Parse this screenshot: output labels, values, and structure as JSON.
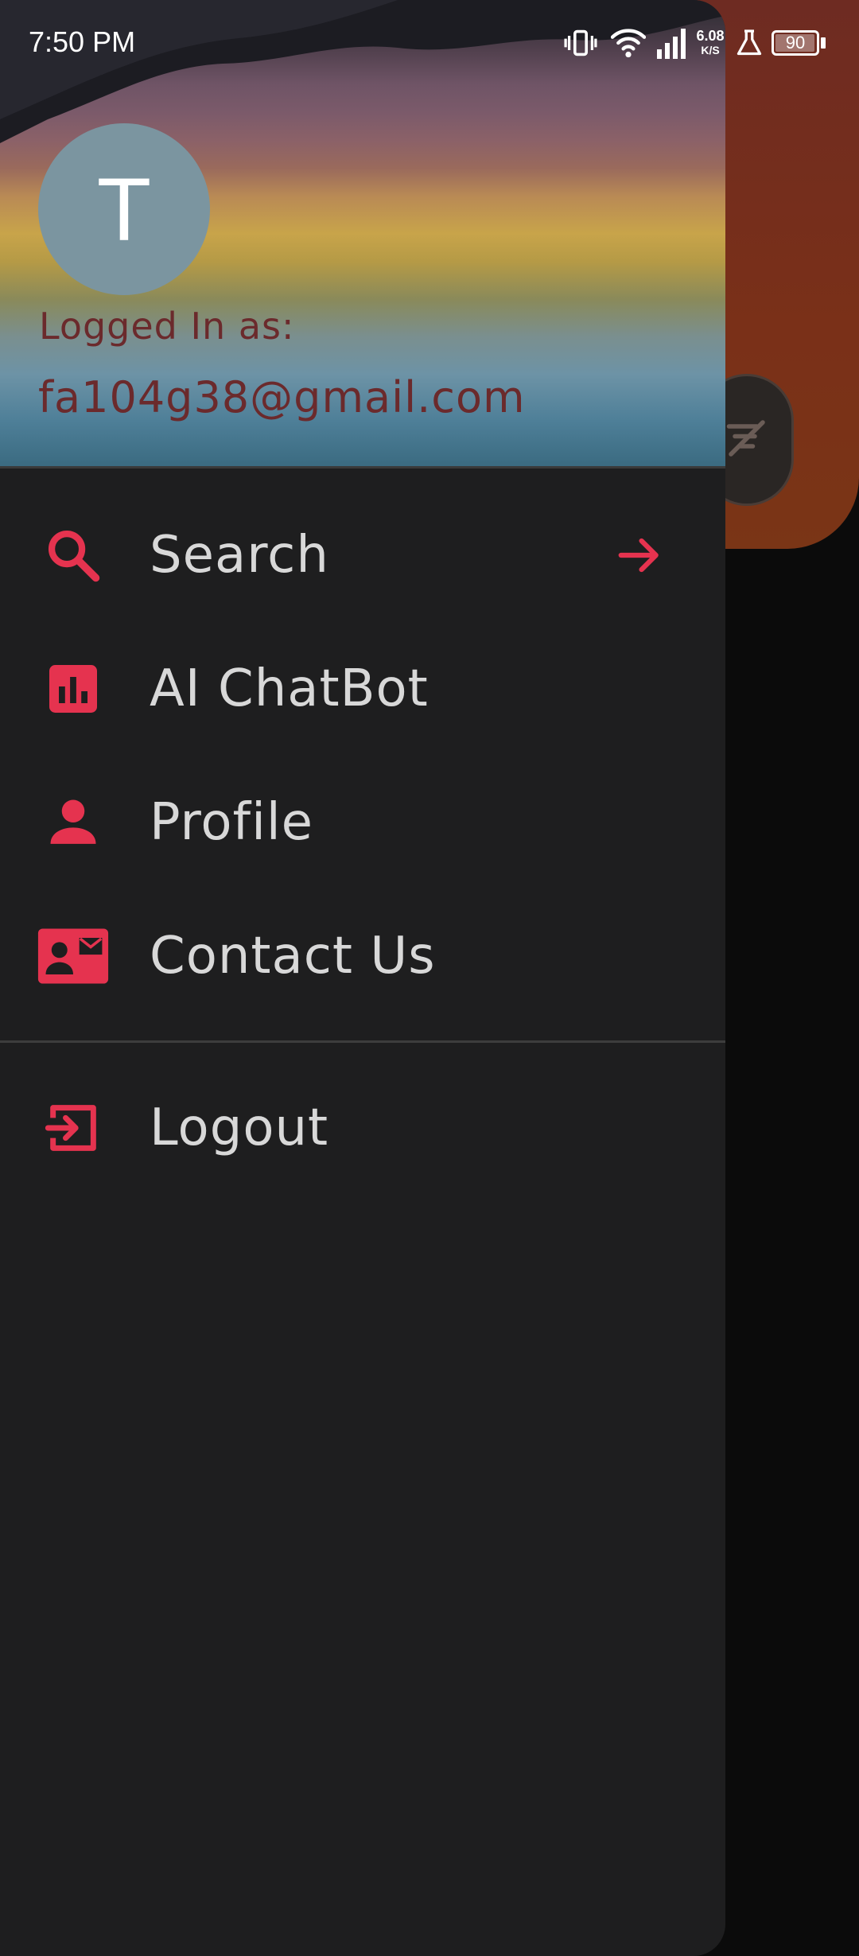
{
  "status_bar": {
    "time": "7:50 PM",
    "net_speed_value": "6.08",
    "net_speed_unit": "K/S",
    "battery_level": "90",
    "icons": [
      "vibrate-icon",
      "wifi-icon",
      "signal-icon",
      "lab-icon",
      "battery-icon"
    ]
  },
  "drawer": {
    "header": {
      "avatar_letter": "T",
      "logged_in_label": "Logged In as:",
      "email": "fa104g38@gmail.com"
    },
    "items": [
      {
        "label": "Search",
        "icon": "search-icon",
        "trailing": "arrow-right-icon"
      },
      {
        "label": "AI ChatBot",
        "icon": "chart-box-icon"
      },
      {
        "label": "Profile",
        "icon": "person-icon"
      },
      {
        "label": "Contact Us",
        "icon": "contact-card-icon"
      }
    ],
    "logout": {
      "label": "Logout",
      "icon": "logout-icon"
    }
  },
  "background": {
    "fab_icon": "filter-off-icon"
  },
  "colors": {
    "accent": "#e5334f",
    "drawer_bg": "#1e1e1f",
    "text": "#d8d8d8",
    "header_text": "#6b2a2c",
    "avatar_bg": "#7b95a0"
  }
}
